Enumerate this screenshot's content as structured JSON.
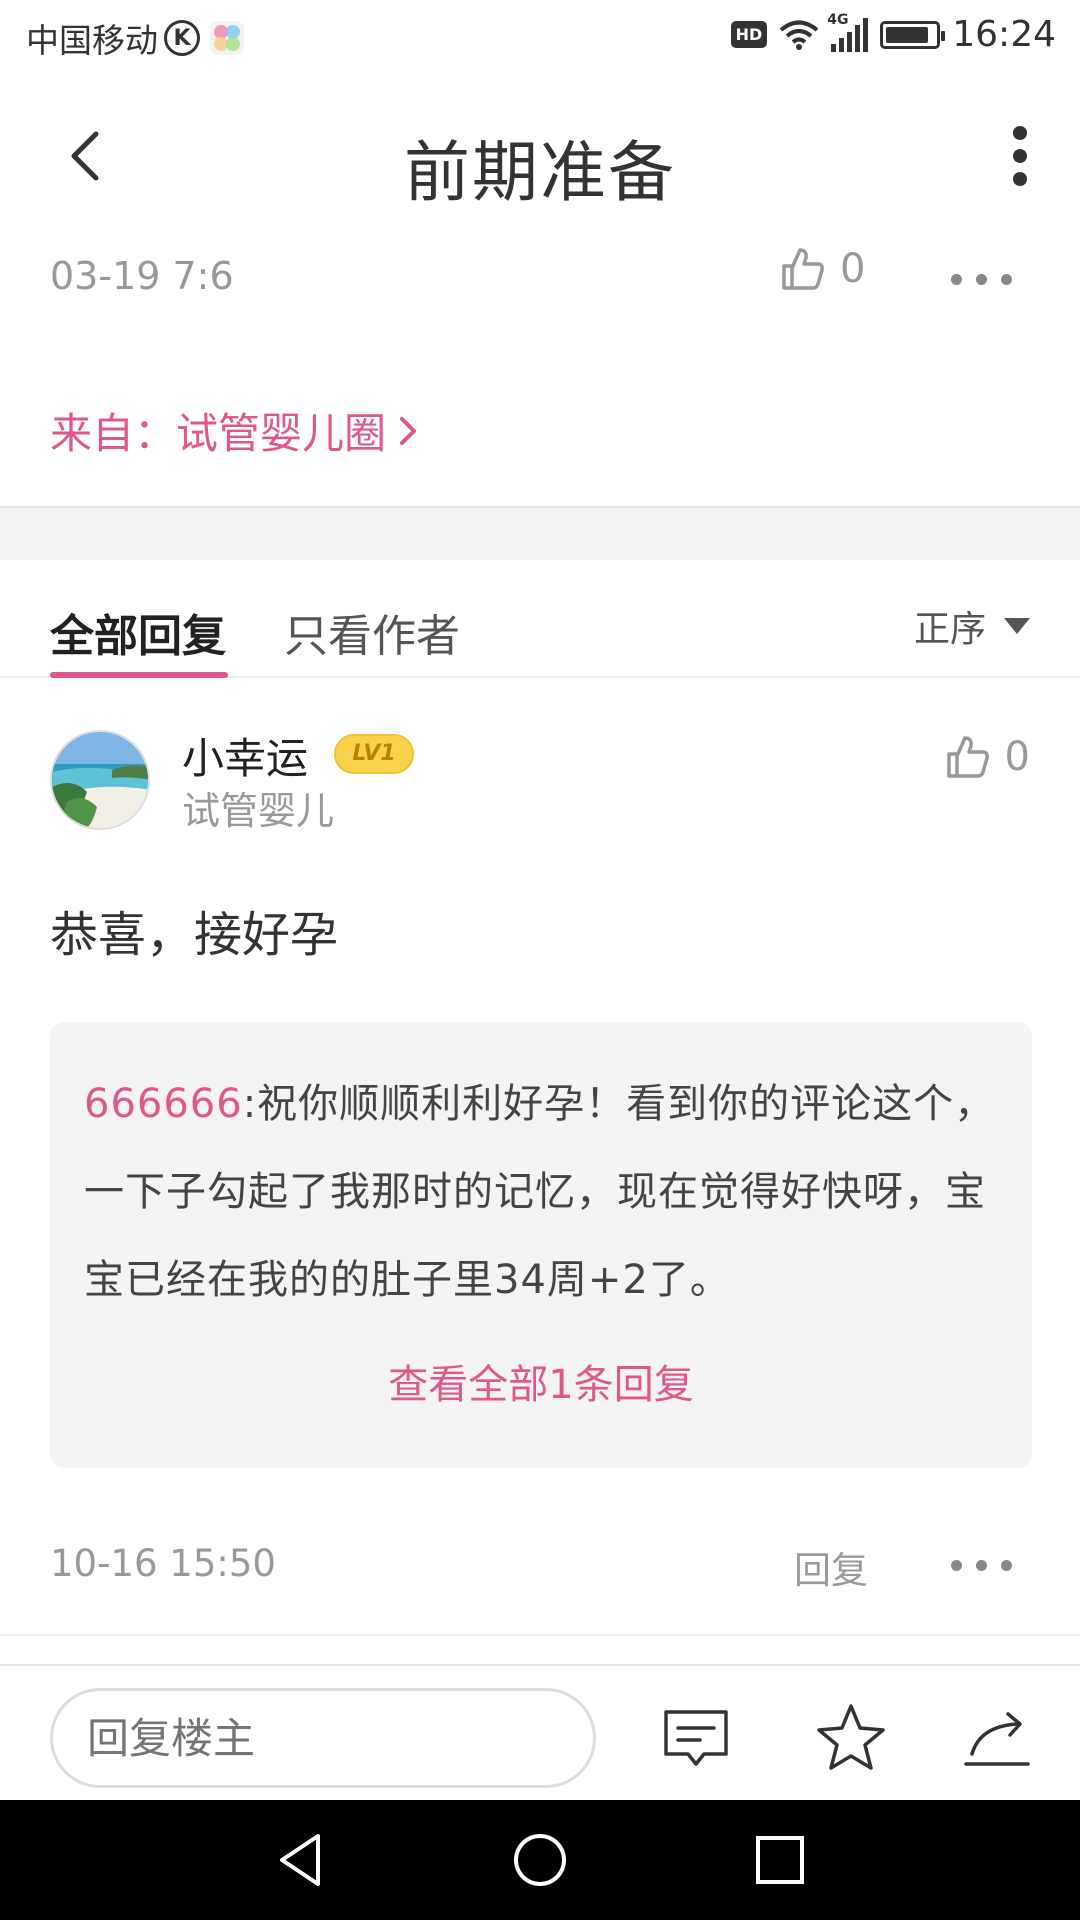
{
  "status_bar": {
    "carrier": "中国移动",
    "k_icon_label": "K",
    "hd_label": "HD",
    "network": "4G",
    "time": "16:24"
  },
  "header": {
    "title": "前期准备"
  },
  "post": {
    "date": "03-19 7:6",
    "like_count": "0",
    "from_text": "来自：试管婴儿圈"
  },
  "tabs": {
    "all_label": "全部回复",
    "author_label": "只看作者",
    "sort_label": "正序"
  },
  "comment": {
    "username": "小幸运",
    "level": "LV1",
    "subtitle": "试管婴儿",
    "like_count": "0",
    "text": "恭喜，接好孕",
    "reply": {
      "name": "666666",
      "text": ":祝你顺顺利利好孕！看到你的评论这个，一下子勾起了我那时的记忆，现在觉得好快呀，宝宝已经在我的的肚子里34周+2了。"
    },
    "view_all_label": "查看全部1条回复",
    "date": "10-16 15:50",
    "reply_label": "回复"
  },
  "bottom_bar": {
    "input_placeholder": "回复楼主"
  },
  "colors": {
    "accent": "#e0578b",
    "muted": "#999999",
    "badge": "#f8d34a"
  }
}
